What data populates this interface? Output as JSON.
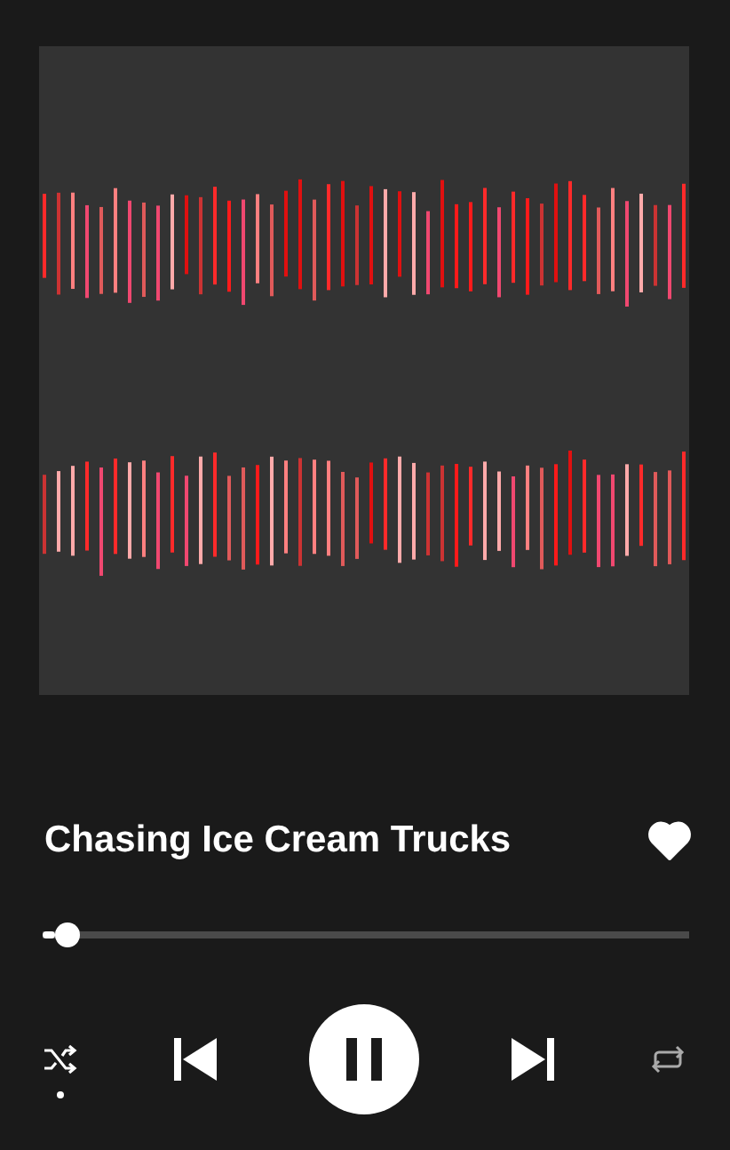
{
  "track": {
    "title": "Chasing Ice Cream Trucks",
    "liked": true
  },
  "progress": {
    "level": 0.02
  },
  "controls": {
    "shuffle": true,
    "playing": true,
    "repeat": false
  }
}
